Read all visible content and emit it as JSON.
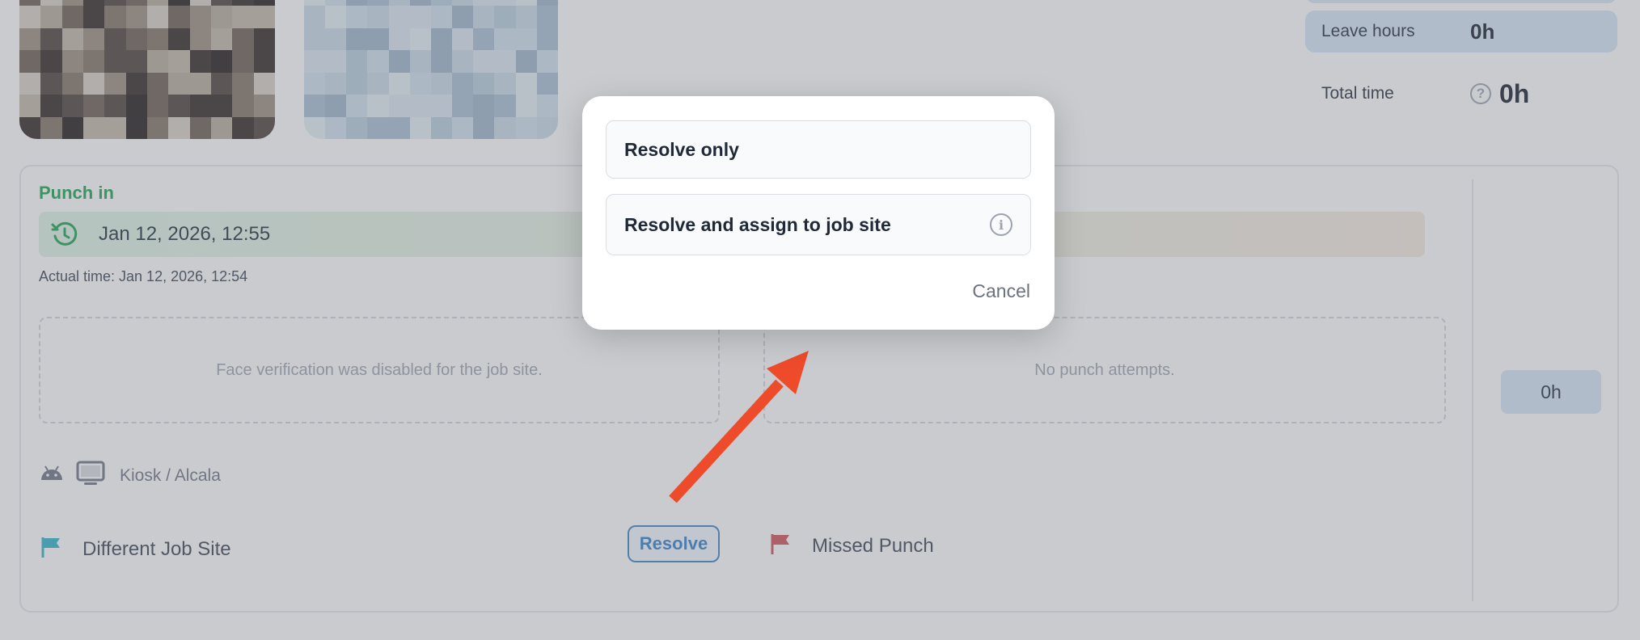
{
  "summary": {
    "leave_hours_label": "Leave hours",
    "leave_hours_value": "0h",
    "total_time_label": "Total time",
    "total_time_help": "?",
    "total_time_value": "0h"
  },
  "punch": {
    "label": "Punch in",
    "datetime": "Jan 12, 2026, 12:55",
    "actual_time": "Actual time: Jan 12, 2026, 12:54",
    "face_verification_text": "Face verification was disabled for the job site.",
    "punch_attempts_text": "No punch attempts.",
    "device_text": "Kiosk / Alcala",
    "flag_label": "Different Job Site",
    "resolve_label": "Resolve",
    "missed_flag_label": "Missed Punch",
    "hours_value": "0h"
  },
  "modal": {
    "option_1": "Resolve only",
    "option_2": "Resolve and assign to job site",
    "info_glyph": "i",
    "cancel_label": "Cancel"
  },
  "colors": {
    "accent_green": "#16a34a",
    "accent_blue": "#2f7ec7",
    "flag_teal": "#2bb3c8",
    "flag_red": "#d14b57",
    "arrow": "#ee4b2b"
  }
}
